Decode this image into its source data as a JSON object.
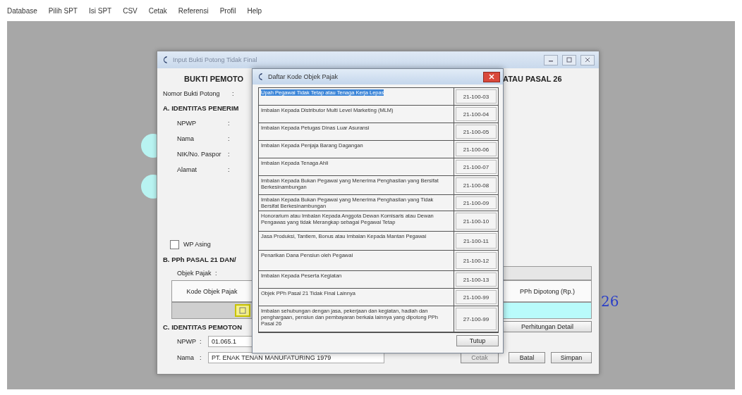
{
  "menu": [
    "Database",
    "Pilih SPT",
    "Isi SPT",
    "CSV",
    "Cetak",
    "Referensi",
    "Profil",
    "Help"
  ],
  "desktop_text": "26",
  "main_window": {
    "title": "Input Bukti Potong Tidak Final",
    "heading_left": "BUKTI PEMOTO",
    "heading_right": "ATAU PASAL 26",
    "nomor": {
      "label": "Nomor Bukti Potong",
      "colon": ":"
    },
    "section_a": "A. IDENTITAS PENERIM",
    "recipient_fields": [
      {
        "label": "NPWP",
        "colon": ":"
      },
      {
        "label": "Nama",
        "colon": ":"
      },
      {
        "label": "NIK/No. Paspor",
        "colon": ":"
      },
      {
        "label": "Alamat",
        "colon": ":"
      }
    ],
    "wp_asing": {
      "label": "WP Asing",
      "checked": false
    },
    "section_b": "B. PPh PASAL 21 DAN/",
    "objek": {
      "label": "Objek Pajak",
      "colon": ":"
    },
    "table": {
      "column_1": "Kode Objek Pajak",
      "column_2": "PPh Dipotong (Rp.)"
    },
    "detail_button": "Perhitungan Detail",
    "section_c": "C. IDENTITAS PEMOTON",
    "cutter_fields": [
      {
        "label": "NPWP",
        "colon": ":",
        "value": "01.065.1"
      },
      {
        "label": "Nama",
        "colon": ":",
        "value": "PT. ENAK TENAN MANUFATURING 1979"
      }
    ],
    "buttons": [
      {
        "label": "Cetak",
        "disabled": true
      },
      {
        "label": "Batal",
        "disabled": false
      },
      {
        "label": "Simpan",
        "disabled": false
      }
    ]
  },
  "dialog": {
    "title": "Daftar Kode Objek Pajak",
    "close_button": "Tutup",
    "rows": [
      {
        "name": "Upah Pegawai Tidak Tetap atau Tenaga Kerja Lepas",
        "code": "21-100-03",
        "selected": true
      },
      {
        "name": "Imbalan Kepada Distributor Multi Level Marketing (MLM)",
        "code": "21-100-04",
        "selected": false
      },
      {
        "name": "Imbalan Kepada Petugas Dinas Luar Asuransi",
        "code": "21-100-05",
        "selected": false
      },
      {
        "name": "Imbalan Kepada Penjaja Barang Dagangan",
        "code": "21-100-06",
        "selected": false
      },
      {
        "name": "Imbalan Kepada Tenaga Ahli",
        "code": "21-100-07",
        "selected": false
      },
      {
        "name": "Imbalan Kepada Bukan Pegawai yang Menerima Penghasilan yang Bersifat Berkesinambungan",
        "code": "21-100-08",
        "selected": false
      },
      {
        "name": "Imbalan Kepada Bukan Pegawai yang Menerima Penghasilan yang Tidak Bersifat Berkesinambungan",
        "code": "21-100-09",
        "selected": false
      },
      {
        "name": "Honorarium atau Imbalan Kepada Anggota Dewan Komisaris atau Dewan Pengawas yang tidak Merangkap sebagai Pegawai Tetap",
        "code": "21-100-10",
        "selected": false
      },
      {
        "name": "Jasa Produksi, Tantiem, Bonus atau Imbalan Kepada Mantan Pegawai",
        "code": "21-100-11",
        "selected": false
      },
      {
        "name": "Penarikan Dana Pensiun oleh Pegawai",
        "code": "21-100-12",
        "selected": false
      },
      {
        "name": "Imbalan Kepada Peserta Kegiatan",
        "code": "21-100-13",
        "selected": false
      },
      {
        "name": "Objek PPh Pasal 21 Tidak Final Lainnya",
        "code": "21-100-99",
        "selected": false
      },
      {
        "name": "Imbalan sehubungan dengan jasa, pekerjaan dan kegiatan, hadiah dan penghargaan, pensiun dan pembayaran berkala lainnya yang dipotong PPh Pasal 26",
        "code": "27-100-99",
        "selected": false
      }
    ]
  }
}
